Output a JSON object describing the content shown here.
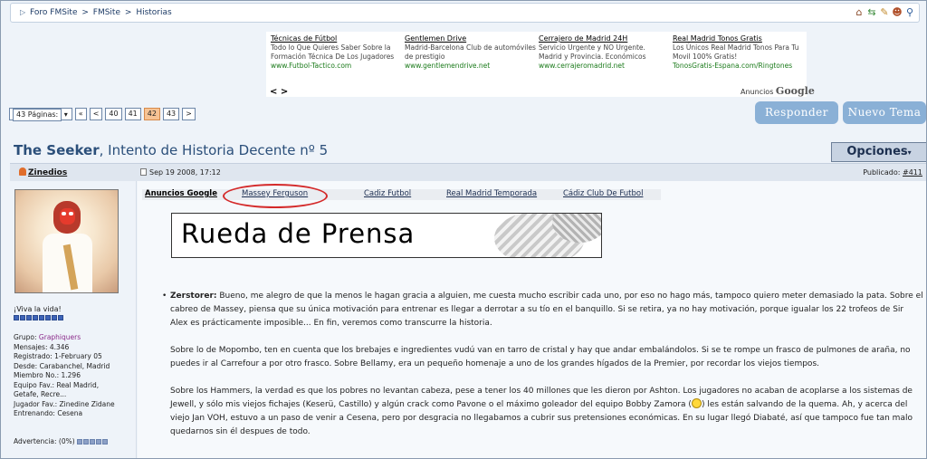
{
  "breadcrumb": {
    "items": [
      "Foro FMSite",
      "FMSite",
      "Historias"
    ],
    "separator": ">"
  },
  "top_icons": [
    "home-icon",
    "arrows-icon",
    "edit-icon",
    "users-icon",
    "search-icon"
  ],
  "ads": [
    {
      "title": "Técnicas de Fútbol",
      "desc": "Todo lo Que Quieres Saber Sobre la Formación Técnica De Los Jugadores",
      "url": "www.Futbol-Tactico.com"
    },
    {
      "title": "Gentlemen Drive",
      "desc": "Madrid-Barcelona Club de automóviles de prestigio",
      "url": "www.gentlemendrive.net"
    },
    {
      "title": "Cerrajero de Madrid 24H",
      "desc": "Servicio Urgente y NO Urgente. Madrid y Provincia. Económicos",
      "url": "www.cerrajeromadrid.net"
    },
    {
      "title": "Real Madrid Tonos Gratis",
      "desc": "Los Únicos Real Madrid Tonos Para Tu Movil 100% Gratis!",
      "url": "TonosGratis-Espana.com/Ringtones"
    }
  ],
  "ad_nav": "< >",
  "ad_footer": {
    "prefix": "Anuncios",
    "brand": "Google"
  },
  "pager": {
    "summary": "43 Páginas:",
    "first": "«",
    "prev": "<",
    "pages": [
      "40",
      "41",
      "42",
      "43"
    ],
    "current": "42",
    "next": ">"
  },
  "buttons": {
    "reply": "Responder",
    "new_topic": "Nuevo Tema",
    "options": "Opciones"
  },
  "thread": {
    "title_bold": "The Seeker",
    "title_rest": ", Intento de Historia Decente nº 5"
  },
  "post": {
    "author": "Zinedios",
    "date": "Sep 19 2008, 17:12",
    "published_label": "Publicado:",
    "post_number": "#411"
  },
  "profile": {
    "motto": "¡Viva la vida!",
    "stats": [
      "Grupo: Graphiquers",
      "Mensajes: 4.346",
      "Registrado: 1-February 05",
      "Desde: Carabanchel, Madrid",
      "Miembro No.: 1.296",
      "Equipo Fav.: Real Madrid, Getafe, Recre...",
      "Jugador Fav.: Zinedine Zidane",
      "Entrenando: Cesena"
    ],
    "warning": "Advertencia: (0%)"
  },
  "ad_links": {
    "lead": "Anuncios Google",
    "items": [
      "Massey Ferguson",
      "Cadiz Futbol",
      "Real Madrid Temporada",
      "Cádiz Club De Futbol"
    ]
  },
  "banner_text": "Rueda de Prensa",
  "body": {
    "speaker": "Zerstorer:",
    "p1": " Bueno, me alegro de que la menos le hagan gracia a alguien, me cuesta mucho escribir cada uno, por eso no hago más, tampoco quiero meter demasiado la pata. Sobre el cabreo de Massey, piensa que su única motivación para entrenar es llegar a derrotar a su tío en el banquillo. Si se retira, ya no hay motivación, porque igualar los 22 trofeos de Sir Alex es prácticamente imposible... En fin, veremos como transcurre la historia.",
    "p2": "Sobre lo de Mopombo, ten en cuenta que los brebajes e ingredientes vudú van en tarro de cristal y hay que andar embalándolos. Si se te rompe un frasco de pulmones de araña, no puedes ir al Carrefour a por otro frasco. Sobre Bellamy, era un pequeño homenaje a uno de los grandes hígados de la Premier, por recordar los viejos tiempos.",
    "p3a": "Sobre los Hammers, la verdad es que los pobres no levantan cabeza, pese a tener los 40 millones que les dieron por Ashton. Los jugadores no acaban de acoplarse a los sistemas de Jewell, y sólo mis viejos fichajes (Keserü, Castillo) y algún crack como Pavone o el máximo goleador del equipo Bobby Zamora (",
    "p3b": ") les están salvando de la quema. Ah, y acerca del viejo Jan VOH, estuvo a un paso de venir a Cesena, pero por desgracia no llegabamos a cubrir sus pretensiones económicas. En su lugar llegó Diabaté, así que tampoco fue tan malo quedarnos sin él despues de todo."
  }
}
